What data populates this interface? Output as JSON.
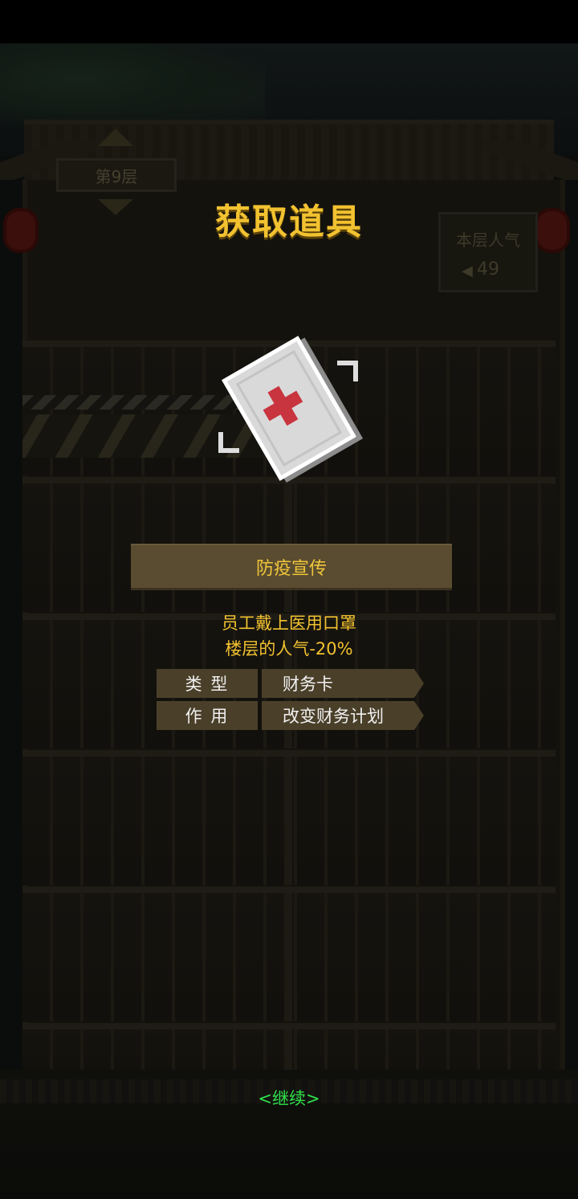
{
  "background": {
    "floor_label": "第9层",
    "popularity_label": "本层人气",
    "popularity_value": "49",
    "icon": "speaker-icon"
  },
  "popup": {
    "title": "获取道具",
    "item_icon": "medical-card-icon",
    "item_name": "防疫宣传",
    "description_line1": "员工戴上医用口罩",
    "description_line2": "楼层的人气-20%",
    "rows": [
      {
        "key": "类 型",
        "value": "财务卡"
      },
      {
        "key": "作 用",
        "value": "改变财务计划"
      }
    ],
    "continue_label": "<继续>"
  },
  "colors": {
    "title": "#f2c230",
    "continue": "#2fe04a",
    "name_bar": "#5a4c30",
    "cross": "#c8353e"
  }
}
